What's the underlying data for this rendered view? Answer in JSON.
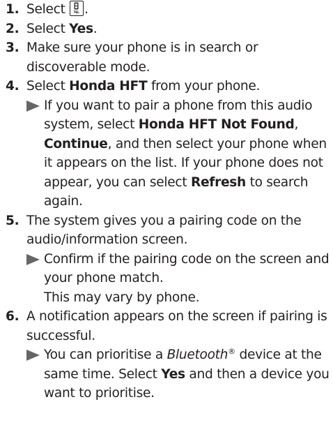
{
  "steps": [
    {
      "num": "1.",
      "text_before": "Select ",
      "icon": "tel-phone-icon",
      "text_after": "."
    },
    {
      "num": "2.",
      "text": "Select ",
      "bold": "Yes",
      "text_after": "."
    },
    {
      "num": "3.",
      "text": "Make sure your phone is in search or discoverable mode."
    },
    {
      "num": "4.",
      "text": "Select ",
      "bold": "Honda HFT",
      "text_after": " from your phone.",
      "note": {
        "t1": "If you want to pair a phone from this audio system, select ",
        "b1": "Honda HFT Not Found",
        "t2": ", ",
        "b2": "Continue",
        "t3": ", and then select your phone when it appears on the list. If your phone does not appear, you can select ",
        "b3": "Refresh",
        "t4": " to search again."
      }
    },
    {
      "num": "5.",
      "text": "The system gives you a pairing code on the audio/information screen.",
      "note": {
        "line1": "Confirm if the pairing code on the screen and your phone match.",
        "line2": "This may vary by phone."
      }
    },
    {
      "num": "6.",
      "text": "A notification appears on the screen if pairing is successful.",
      "note": {
        "t1": "You can prioritise a ",
        "italic": "Bluetooth",
        "sup": "®",
        "t2": " device at the same time. Select ",
        "b1": "Yes",
        "t3": " and then a device you want to prioritise."
      }
    }
  ],
  "icon_label": "TEL",
  "colors": {
    "text": "#231f20",
    "arrow": "#666666"
  }
}
